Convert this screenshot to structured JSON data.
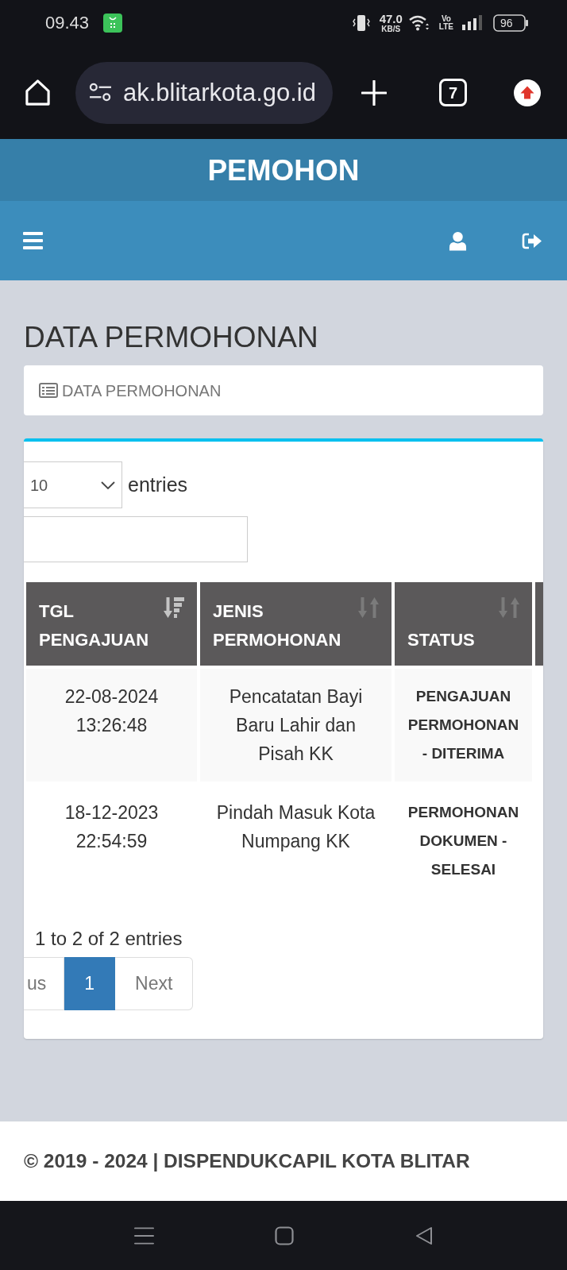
{
  "status_bar": {
    "time": "09.43",
    "net_speed": "47.0",
    "net_unit": "KB/S",
    "volte_top": "Vo",
    "volte_bottom": "LTE",
    "battery": "96"
  },
  "browser_bar": {
    "url": "ak.blitarkota.go.id",
    "tab_count": "7"
  },
  "app_header": {
    "title": "PEMOHON"
  },
  "page": {
    "title": "DATA PERMOHONAN",
    "breadcrumb": "DATA PERMOHONAN"
  },
  "length_control": {
    "value": "10",
    "suffix": "entries"
  },
  "table": {
    "columns": [
      {
        "label": "TGL PENGAJUAN",
        "sorted": true
      },
      {
        "label": "JENIS PERMOHONAN",
        "sorted": false
      },
      {
        "label": "STATUS",
        "sorted": false
      }
    ],
    "rows": [
      {
        "cells": [
          "22-08-2024 13:26:48",
          "Pencatatan Bayi Baru Lahir dan Pisah KK",
          "PENGAJUAN PERMOHONAN - DITERIMA"
        ]
      },
      {
        "cells": [
          "18-12-2023 22:54:59",
          "Pindah Masuk Kota Numpang KK",
          "PERMOHONAN DOKUMEN - SELESAI"
        ]
      }
    ]
  },
  "info": "1 to 2 of 2 entries",
  "pagination": [
    {
      "label": "us",
      "selected": false
    },
    {
      "label": "1",
      "selected": true
    },
    {
      "label": "Next",
      "selected": false
    }
  ],
  "footer": {
    "text": "© 2019 - 2024 | DISPENDUKCAPIL KOTA BLITAR"
  }
}
